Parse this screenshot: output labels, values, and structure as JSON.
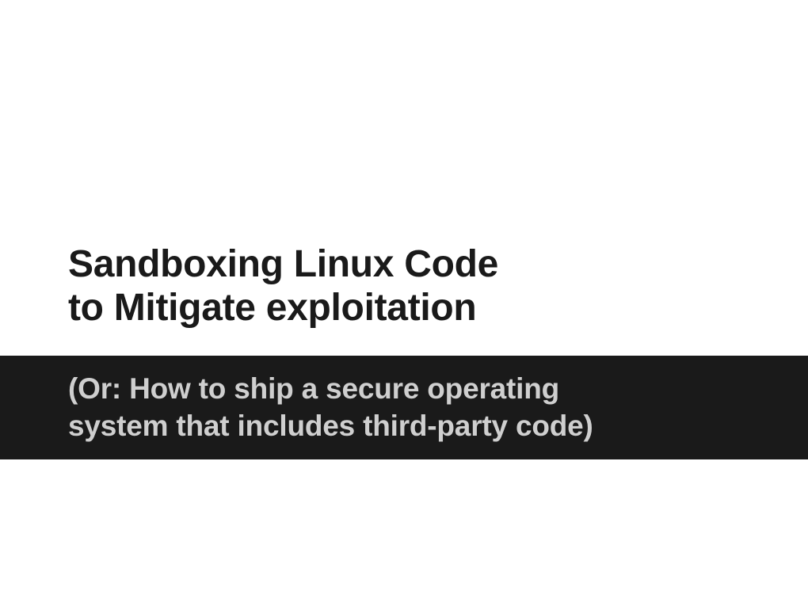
{
  "slide": {
    "title_line_1": "Sandboxing Linux Code",
    "title_line_2": "to Mitigate exploitation",
    "subtitle_line_1": "(Or: How to ship a secure operating",
    "subtitle_line_2": "system that includes third-party code)"
  }
}
